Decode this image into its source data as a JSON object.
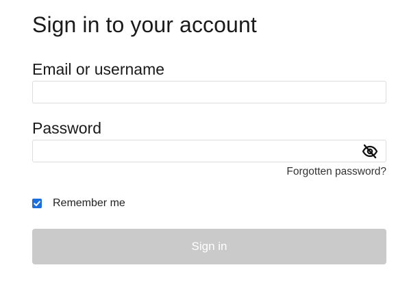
{
  "page": {
    "title": "Sign in to your account"
  },
  "email": {
    "label": "Email or username",
    "value": "",
    "placeholder": ""
  },
  "password": {
    "label": "Password",
    "value": "",
    "placeholder": "",
    "toggle_icon": "eye-slash-icon"
  },
  "forgot": {
    "label": "Forgotten password?"
  },
  "remember": {
    "label": "Remember me",
    "checked": true
  },
  "submit": {
    "label": "Sign in",
    "disabled": true
  },
  "colors": {
    "checkbox_accent": "#1a6ee0",
    "button_disabled_bg": "#cacaca",
    "input_border": "#dcdcdc"
  }
}
